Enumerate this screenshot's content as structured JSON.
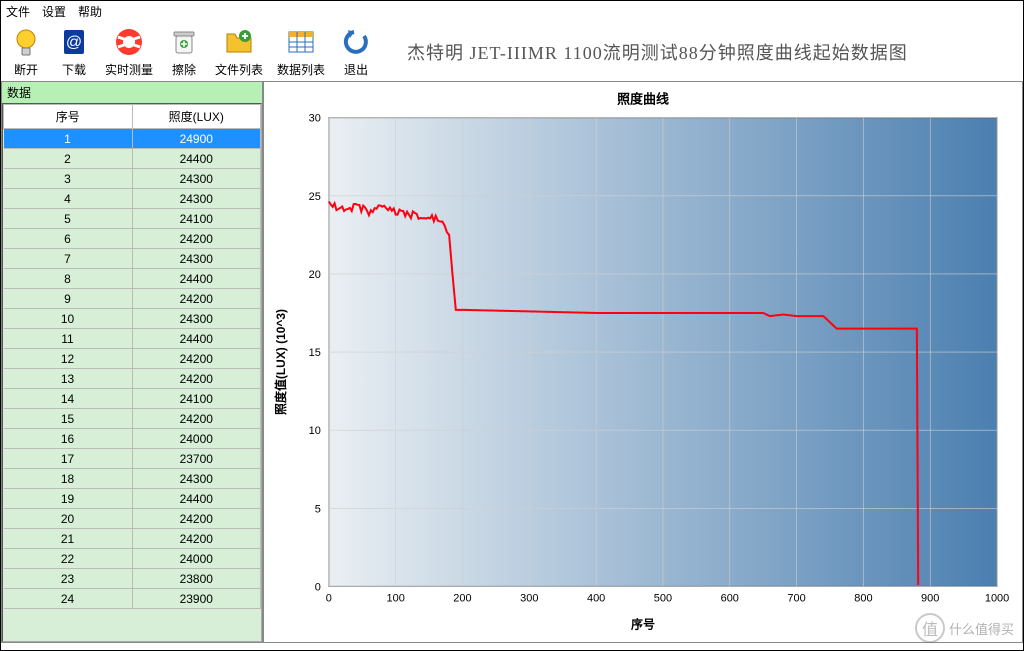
{
  "menu": {
    "file": "文件",
    "settings": "设置",
    "help": "帮助"
  },
  "toolbar": {
    "disconnect": "断开",
    "download": "下载",
    "realtime": "实时测量",
    "erase": "擦除",
    "filelist": "文件列表",
    "datalist": "数据列表",
    "exit": "退出",
    "title": "杰特明 JET-IIIMR 1100流明测试88分钟照度曲线起始数据图"
  },
  "panel": {
    "header": "数据"
  },
  "table": {
    "col_index": "序号",
    "col_lux": "照度(LUX)",
    "rows": [
      {
        "i": 1,
        "v": 24900
      },
      {
        "i": 2,
        "v": 24400
      },
      {
        "i": 3,
        "v": 24300
      },
      {
        "i": 4,
        "v": 24300
      },
      {
        "i": 5,
        "v": 24100
      },
      {
        "i": 6,
        "v": 24200
      },
      {
        "i": 7,
        "v": 24300
      },
      {
        "i": 8,
        "v": 24400
      },
      {
        "i": 9,
        "v": 24200
      },
      {
        "i": 10,
        "v": 24300
      },
      {
        "i": 11,
        "v": 24400
      },
      {
        "i": 12,
        "v": 24200
      },
      {
        "i": 13,
        "v": 24200
      },
      {
        "i": 14,
        "v": 24100
      },
      {
        "i": 15,
        "v": 24200
      },
      {
        "i": 16,
        "v": 24000
      },
      {
        "i": 17,
        "v": 23700
      },
      {
        "i": 18,
        "v": 24300
      },
      {
        "i": 19,
        "v": 24400
      },
      {
        "i": 20,
        "v": 24200
      },
      {
        "i": 21,
        "v": 24200
      },
      {
        "i": 22,
        "v": 24000
      },
      {
        "i": 23,
        "v": 23800
      },
      {
        "i": 24,
        "v": 23900
      }
    ],
    "selected_index": 1
  },
  "chart_data": {
    "type": "line",
    "title": "照度曲线",
    "xlabel": "序号",
    "ylabel": "照度值(LUX) (10^3)",
    "xlim": [
      0,
      1000
    ],
    "ylim": [
      0,
      30
    ],
    "xticks": [
      0,
      100,
      200,
      300,
      400,
      500,
      600,
      700,
      800,
      900,
      1000
    ],
    "yticks": [
      0,
      5,
      10,
      15,
      20,
      25,
      30
    ],
    "series": [
      {
        "name": "lux",
        "color": "#ff0011",
        "points": [
          [
            0,
            24.5
          ],
          [
            20,
            24.2
          ],
          [
            40,
            24.3
          ],
          [
            60,
            24.0
          ],
          [
            80,
            24.2
          ],
          [
            100,
            24.0
          ],
          [
            120,
            23.8
          ],
          [
            140,
            23.7
          ],
          [
            160,
            23.5
          ],
          [
            170,
            23.2
          ],
          [
            180,
            22.5
          ],
          [
            185,
            20.0
          ],
          [
            190,
            17.7
          ],
          [
            200,
            17.7
          ],
          [
            300,
            17.6
          ],
          [
            400,
            17.5
          ],
          [
            500,
            17.5
          ],
          [
            600,
            17.5
          ],
          [
            650,
            17.5
          ],
          [
            660,
            17.3
          ],
          [
            680,
            17.4
          ],
          [
            700,
            17.3
          ],
          [
            740,
            17.3
          ],
          [
            760,
            16.5
          ],
          [
            780,
            16.5
          ],
          [
            800,
            16.5
          ],
          [
            860,
            16.5
          ],
          [
            880,
            16.5
          ],
          [
            882,
            0.1
          ]
        ]
      }
    ]
  },
  "watermark": "什么值得买"
}
